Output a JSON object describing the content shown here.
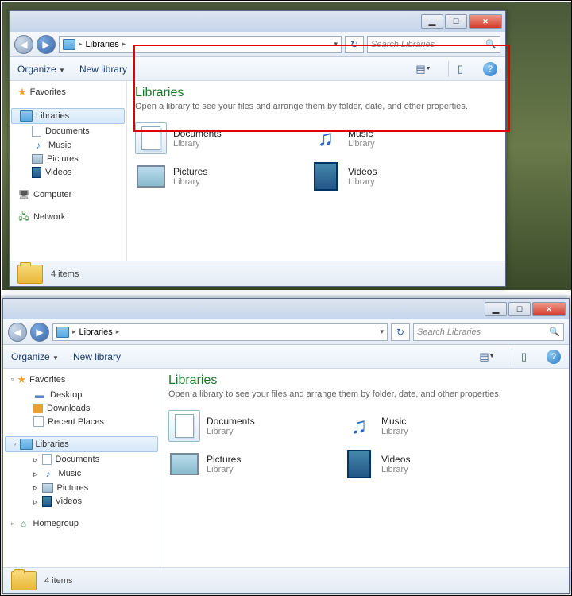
{
  "window1": {
    "nav_back": "◀",
    "nav_fwd": "▶",
    "address": "Libraries",
    "search_placeholder": "Search Libraries",
    "cmd_organize": "Organize",
    "cmd_newlib": "New library",
    "sidebar": {
      "favorites": "Favorites",
      "libraries": "Libraries",
      "lib_items": [
        {
          "label": "Documents"
        },
        {
          "label": "Music"
        },
        {
          "label": "Pictures"
        },
        {
          "label": "Videos"
        }
      ],
      "computer": "Computer",
      "network": "Network"
    },
    "content": {
      "title": "Libraries",
      "subtitle": "Open a library to see your files and arrange them by folder, date, and other properties.",
      "items": [
        {
          "name": "Documents",
          "type": "Library",
          "kind": "doc"
        },
        {
          "name": "Music",
          "type": "Library",
          "kind": "mus"
        },
        {
          "name": "Pictures",
          "type": "Library",
          "kind": "pic"
        },
        {
          "name": "Videos",
          "type": "Library",
          "kind": "vid"
        }
      ]
    },
    "status": "4 items"
  },
  "window2": {
    "nav_back": "◀",
    "nav_fwd": "▶",
    "address": "Libraries",
    "search_placeholder": "Search Libraries",
    "cmd_organize": "Organize",
    "cmd_newlib": "New library",
    "sidebar": {
      "favorites": "Favorites",
      "fav_items": [
        {
          "label": "Desktop"
        },
        {
          "label": "Downloads"
        },
        {
          "label": "Recent Places"
        }
      ],
      "libraries": "Libraries",
      "lib_items": [
        {
          "label": "Documents"
        },
        {
          "label": "Music"
        },
        {
          "label": "Pictures"
        },
        {
          "label": "Videos"
        }
      ],
      "homegroup": "Homegroup"
    },
    "content": {
      "title": "Libraries",
      "subtitle": "Open a library to see your files and arrange them by folder, date, and other properties.",
      "items": [
        {
          "name": "Documents",
          "type": "Library",
          "kind": "doc"
        },
        {
          "name": "Music",
          "type": "Library",
          "kind": "mus"
        },
        {
          "name": "Pictures",
          "type": "Library",
          "kind": "pic"
        },
        {
          "name": "Videos",
          "type": "Library",
          "kind": "vid"
        }
      ]
    },
    "status": "4 items"
  }
}
